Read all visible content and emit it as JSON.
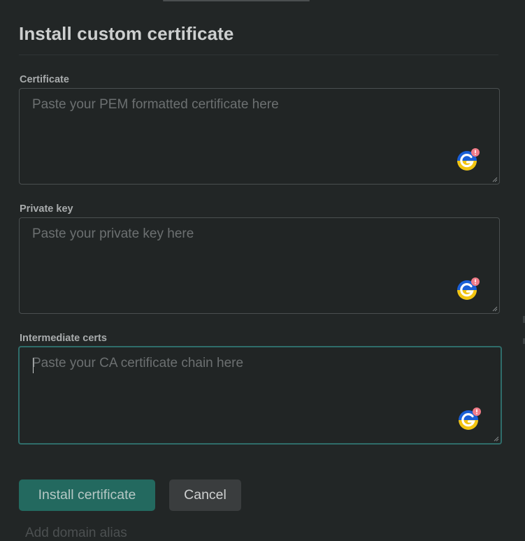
{
  "dialog": {
    "title": "Install custom certificate"
  },
  "fields": [
    {
      "label": "Certificate",
      "placeholder": "Paste your PEM formatted certificate here",
      "value": ""
    },
    {
      "label": "Private key",
      "placeholder": "Paste your private key here",
      "value": ""
    },
    {
      "label": "Intermediate certs",
      "placeholder": "Paste your CA certificate chain here",
      "value": ""
    }
  ],
  "actions": {
    "install_label": "Install certificate",
    "cancel_label": "Cancel"
  },
  "background": {
    "partial_text": "Add domain alias"
  },
  "colors": {
    "primary_button": "#23695f",
    "focus_border": "#2f6d6a",
    "background": "#222626",
    "grammar_badge_blue": "#1a5fd6",
    "grammar_badge_yellow": "#f2c40f",
    "grammar_badge_alert": "#f07b87"
  },
  "icons": {
    "grammar_checker": "grammar-check-icon",
    "resize": "resize-grip-icon"
  }
}
